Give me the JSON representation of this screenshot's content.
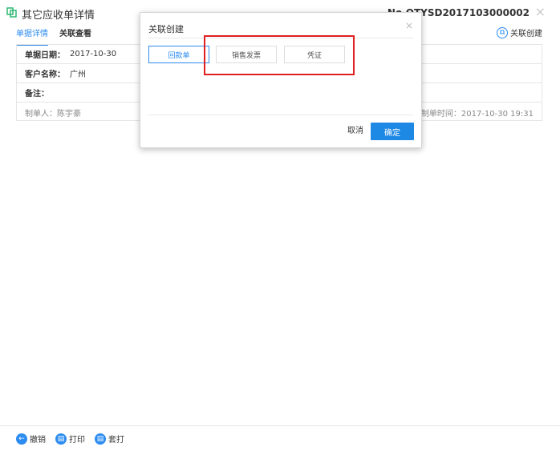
{
  "header": {
    "title": "其它应收单详情",
    "doc_no": "No.QTYSD2017103000002",
    "close_glyph": "×",
    "title_icon": "document-link-icon"
  },
  "tabs": [
    {
      "label": "单据详情",
      "active": true
    },
    {
      "label": "关联查看",
      "active": false
    }
  ],
  "linked_create": {
    "label": "关联创建",
    "icon": "link-create-icon"
  },
  "form": {
    "date_label": "单据日期：",
    "date_value": "2017-10-30",
    "customer_label": "客户名称：",
    "customer_value": "广州",
    "remark_label": "备注：",
    "remark_value": "",
    "creator": "制单人：陈宇豪",
    "created_time": "制单时间：2017-10-30 19:31"
  },
  "modal": {
    "title": "关联创建",
    "close_glyph": "×",
    "options": [
      "回款单",
      "销售发票",
      "凭证"
    ],
    "cancel_label": "取消",
    "ok_label": "确定",
    "highlight_color": "#e02020"
  },
  "bottom": {
    "items": [
      {
        "label": "撤销",
        "icon": "undo-icon"
      },
      {
        "label": "打印",
        "icon": "print-icon"
      },
      {
        "label": "套打",
        "icon": "template-print-icon"
      }
    ]
  },
  "colors": {
    "accent": "#2d8cf0",
    "primary_button": "#1e88e5"
  }
}
